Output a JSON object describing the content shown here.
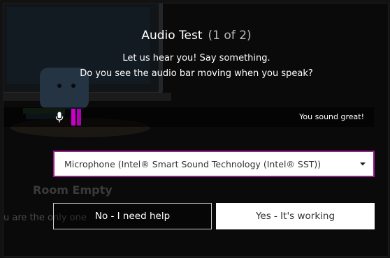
{
  "dialog": {
    "title": "Audio Test",
    "step": "(1 of 2)",
    "prompt_line1": "Let us hear you! Say something.",
    "prompt_line2": "Do you see the audio bar moving when you speak?"
  },
  "meter": {
    "status_text": "You sound great!",
    "level": 0.03,
    "bar_color": "#cc00cc"
  },
  "device_select": {
    "selected_value": "Microphone (Intel® Smart Sound Technology (Intel® SST))",
    "border_color": "#9a1e8e"
  },
  "buttons": {
    "help_label": "No - I need help",
    "yes_label": "Yes - It's working"
  },
  "background": {
    "room_title": "Room Empty",
    "room_message": "u are the only one"
  },
  "icons": {
    "microphone": "microphone-icon",
    "dropdown": "chevron-down-icon"
  }
}
